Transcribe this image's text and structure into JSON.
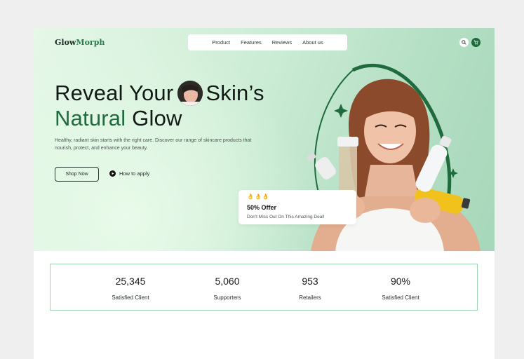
{
  "brand": {
    "logo_prefix": "Glow",
    "logo_suffix": "Morph"
  },
  "nav": {
    "items": [
      "Product",
      "Features",
      "Reviews",
      "About us"
    ]
  },
  "icons": {
    "search": "search-icon",
    "cart": "cart-icon",
    "play": "play-icon"
  },
  "colors": {
    "accent": "#1f6b3e",
    "hero_bg": "#cfeed8",
    "stats_border": "#9fd4b3"
  },
  "hero": {
    "line1_a": "Reveal Your",
    "line1_b": "Skin’s",
    "line2_green": "Natural",
    "line2_rest": "Glow",
    "description": "Healthy, radiant skin starts with the right care. Discover our range of skincare products that nourish, protect, and enhance your beauty.",
    "shop_label": "Shop Now",
    "how_label": "How to apply"
  },
  "offer": {
    "emoji": "👌👌👌",
    "title": "50% Offer",
    "subtitle": "Don't Miss Out On This Amazing Deal!"
  },
  "stats": [
    {
      "value": "25,345",
      "label": "Satisfied Client"
    },
    {
      "value": "5,060",
      "label": "Supporters"
    },
    {
      "value": "953",
      "label": "Retailers"
    },
    {
      "value": "90%",
      "label": "Satisfied Client"
    }
  ]
}
